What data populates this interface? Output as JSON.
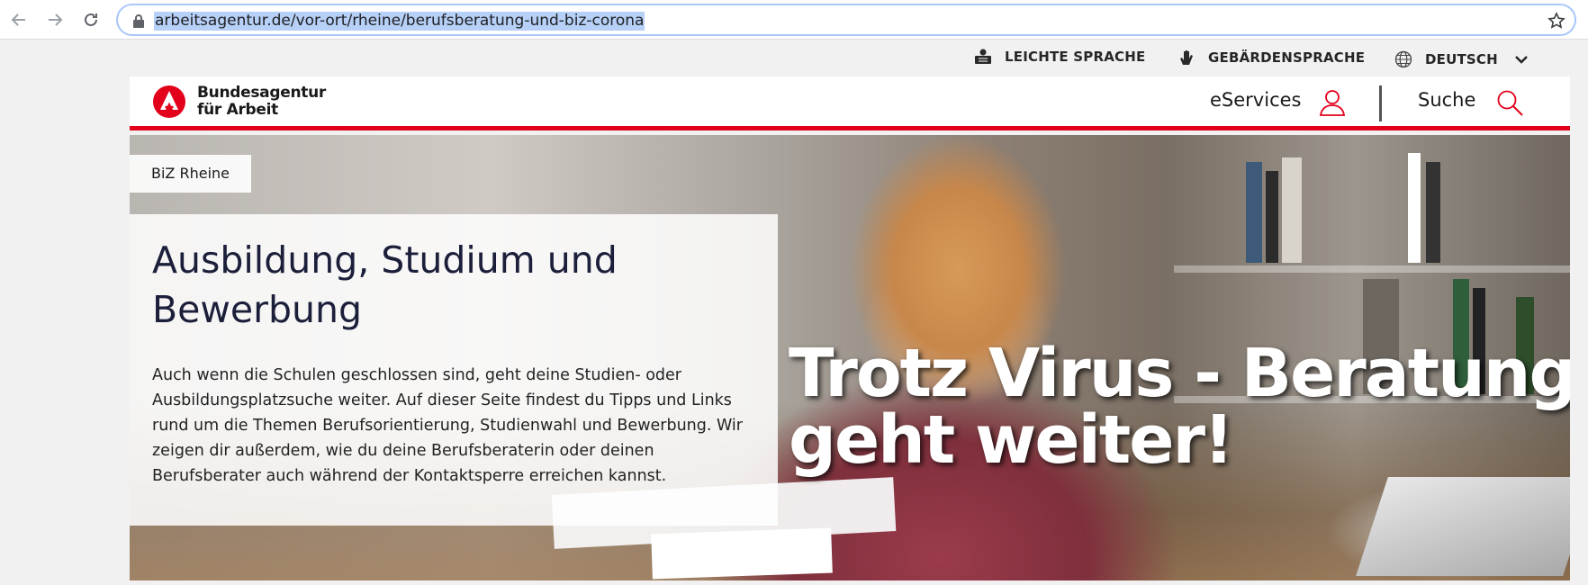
{
  "browser": {
    "url": "arbeitsagentur.de/vor-ort/rheine/berufsberatung-und-biz-corona"
  },
  "utility_bar": {
    "easy_language": "LEICHTE SPRACHE",
    "sign_language": "GEBÄRDENSPRACHE",
    "language": "DEUTSCH"
  },
  "header": {
    "logo_line1": "Bundesagentur",
    "logo_line2": "für Arbeit",
    "eservices": "eServices",
    "search": "Suche",
    "brand_color": "#e2001a"
  },
  "hero": {
    "tag": "BiZ Rheine",
    "title": "Ausbildung, Studium und Bewerbung",
    "description": "Auch wenn die Schulen geschlossen sind, geht deine Studien- oder Ausbildungsplatzsuche weiter. Auf dieser Seite findest du Tipps und Links rund um die Themen Berufsorientierung, Studienwahl und Bewerbung. Wir zeigen dir außerdem, wie du deine Berufsberaterin oder deinen Berufsberater auch während der Kontaktsperre erreichen kannst.",
    "headline_line1": "Trotz Virus - Beratung",
    "headline_line2": "geht weiter!"
  }
}
